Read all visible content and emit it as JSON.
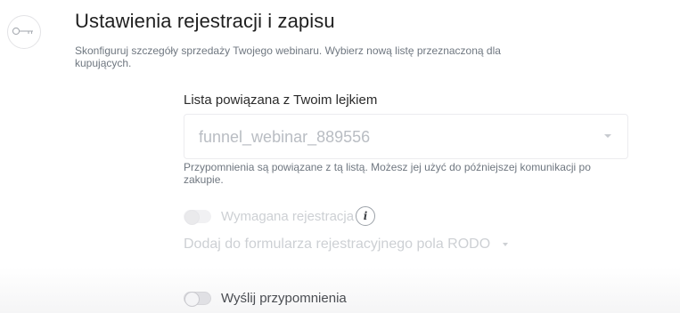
{
  "header": {
    "icon": "key-icon",
    "title": "Ustawienia rejestracji i zapisu",
    "subtitle": "Skonfiguruj szczegóły sprzedaży Twojego webinaru. Wybierz nową listę przeznaczoną dla kupujących."
  },
  "list": {
    "label": "Lista powiązana z Twoim lejkiem",
    "selected_value": "funnel_webinar_889556",
    "helper_text": "Przypomnienia są powiązane z tą listą. Możesz jej użyć do późniejszej komunikacji po zakupie."
  },
  "registration": {
    "toggle_label": "Wymagana rejestracja",
    "toggle_on": false,
    "disabled": true,
    "info_glyph": "i",
    "rodo_link": "Dodaj do formularza rejestracyjnego pola RODO"
  },
  "reminders": {
    "toggle_label": "Wyślij przypomnienia",
    "toggle_on": false
  },
  "colors": {
    "title": "#1f1f1f",
    "muted_text": "#6f7780",
    "disabled_text": "#cdd0d4",
    "placeholder_text": "#b9bdc3"
  }
}
